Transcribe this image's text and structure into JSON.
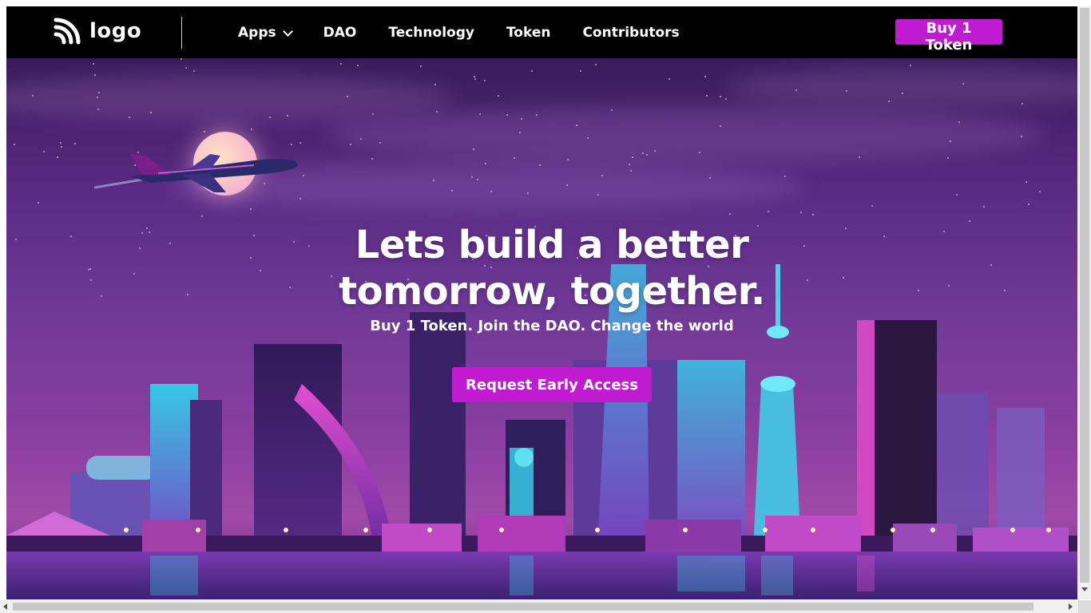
{
  "nav": {
    "logo_text": "logo",
    "links": [
      {
        "label": "Apps"
      },
      {
        "label": "DAO"
      },
      {
        "label": "Technology"
      },
      {
        "label": "Token"
      },
      {
        "label": "Contributors"
      }
    ],
    "buy_label": "Buy 1 Token"
  },
  "hero": {
    "title_line1": "Lets build a better",
    "title_line2": "tomorrow, together.",
    "subtitle": "Buy 1 Token. Join the DAO. Change the world",
    "cta_label": "Request Early Access"
  },
  "colors": {
    "accent": "#c01bd0",
    "nav_bg": "#000000",
    "sky_top": "#3a1a5c",
    "sky_mid": "#6d3896"
  },
  "icons": {
    "logo": "logo-feed-icon",
    "apps_dropdown": "chevron-down-icon"
  }
}
